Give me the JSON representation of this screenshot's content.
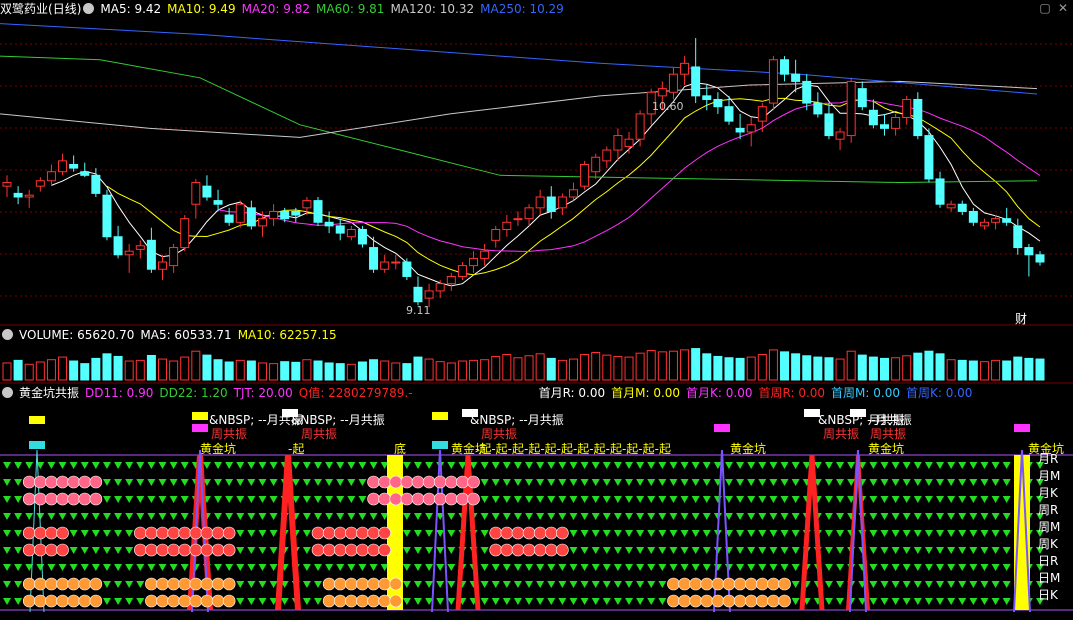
{
  "window": {
    "title": "双鹭药业",
    "period": "(日线)"
  },
  "price_panel": {
    "ma": [
      {
        "label": "MA5: 9.42",
        "color": "#ffffff"
      },
      {
        "label": "MA10: 9.49",
        "color": "#ffff00"
      },
      {
        "label": "MA20: 9.82",
        "color": "#ff33ff"
      },
      {
        "label": "MA60: 9.81",
        "color": "#33cc33"
      },
      {
        "label": "MA120: 10.32",
        "color": "#c8c8c8"
      },
      {
        "label": "MA250: 10.29",
        "color": "#3366ff"
      }
    ],
    "high_label": "10.60",
    "low_label": "9.11",
    "badge": "财"
  },
  "volume_panel": {
    "title": "VOLUME: 65620.70",
    "ma5": "MA5: 60533.71",
    "ma10": "MA10: 62257.15"
  },
  "indicator_panel": {
    "title": "黄金坑共振",
    "params": [
      {
        "label": "DD11: 0.90",
        "color": "#ff33ff"
      },
      {
        "label": "DD22: 1.20",
        "color": "#33cc33"
      },
      {
        "label": "TJT: 20.00",
        "color": "#ff33ff"
      },
      {
        "label": "Q值: 2280279789.-",
        "color": "#ff2222"
      },
      {
        "label": "首月R: 0.00",
        "color": "#ffffff"
      },
      {
        "label": "首月M: 0.00",
        "color": "#ffff00"
      },
      {
        "label": "首月K: 0.00",
        "color": "#ff33ff"
      },
      {
        "label": "首周R: 0.00",
        "color": "#ff2222"
      },
      {
        "label": "首周M: 0.00",
        "color": "#33ccff"
      },
      {
        "label": "首周K: 0.00",
        "color": "#3366ff"
      }
    ],
    "row_labels": [
      "月R",
      "月M",
      "月K",
      "周R",
      "周M",
      "周K",
      "日R",
      "日M",
      "日K"
    ],
    "texts": {
      "nbsp_a": "&NBSP; --月共振",
      "nbsp_b": "&NBSP; --月共振",
      "nbsp_c": "&NBSP; --月共振",
      "nbsp_d": "&NBSP; --月共振",
      "zhou_a": "周共振",
      "zhou_b": "周共振",
      "zhou_c": "周共振",
      "zhou_d": "周共振",
      "zhou_e": "周共振",
      "hjk_a": "黄金坑",
      "hjk_b": "黄金坑",
      "hjk_c": "黄金坑",
      "hjk_d": "黄金坑",
      "hjk_e": "黄金坑",
      "di": "底",
      "qi": "-起",
      "qi_run": "-起-起-起-起-起-起-起-起-起-起-起-起",
      "yue_gong": "月共振"
    }
  },
  "chart_data": {
    "type": "candlestick",
    "title": "双鹭药业 (日线)",
    "annotations": {
      "high": 10.6,
      "low": 9.11
    },
    "y_ticks_hidden": true,
    "ma_values": {
      "MA5": 9.42,
      "MA10": 9.49,
      "MA20": 9.82,
      "MA60": 9.81,
      "MA120": 10.32,
      "MA250": 10.29
    },
    "candles": [
      [
        9.78,
        9.84,
        9.72,
        9.8
      ],
      [
        9.74,
        9.78,
        9.68,
        9.72
      ],
      [
        9.72,
        9.76,
        9.66,
        9.73
      ],
      [
        9.78,
        9.83,
        9.75,
        9.81
      ],
      [
        9.81,
        9.9,
        9.79,
        9.86
      ],
      [
        9.86,
        9.96,
        9.84,
        9.92
      ],
      [
        9.9,
        9.95,
        9.86,
        9.88
      ],
      [
        9.86,
        9.91,
        9.83,
        9.84
      ],
      [
        9.84,
        9.88,
        9.72,
        9.74
      ],
      [
        9.73,
        9.76,
        9.48,
        9.5
      ],
      [
        9.5,
        9.56,
        9.38,
        9.4
      ],
      [
        9.4,
        9.46,
        9.3,
        9.42
      ],
      [
        9.43,
        9.48,
        9.38,
        9.45
      ],
      [
        9.48,
        9.55,
        9.3,
        9.32
      ],
      [
        9.32,
        9.4,
        9.26,
        9.36
      ],
      [
        9.34,
        9.46,
        9.3,
        9.44
      ],
      [
        9.44,
        9.62,
        9.42,
        9.6
      ],
      [
        9.68,
        9.82,
        9.6,
        9.8
      ],
      [
        9.78,
        9.84,
        9.7,
        9.72
      ],
      [
        9.7,
        9.76,
        9.64,
        9.68
      ],
      [
        9.62,
        9.66,
        9.56,
        9.58
      ],
      [
        9.58,
        9.7,
        9.55,
        9.68
      ],
      [
        9.66,
        9.7,
        9.54,
        9.56
      ],
      [
        9.56,
        9.64,
        9.5,
        9.6
      ],
      [
        9.6,
        9.68,
        9.56,
        9.64
      ],
      [
        9.64,
        9.66,
        9.58,
        9.6
      ],
      [
        9.64,
        9.66,
        9.58,
        9.62
      ],
      [
        9.66,
        9.72,
        9.62,
        9.7
      ],
      [
        9.7,
        9.72,
        9.56,
        9.58
      ],
      [
        9.58,
        9.64,
        9.52,
        9.56
      ],
      [
        9.56,
        9.6,
        9.48,
        9.52
      ],
      [
        9.5,
        9.56,
        9.48,
        9.54
      ],
      [
        9.54,
        9.56,
        9.44,
        9.46
      ],
      [
        9.44,
        9.5,
        9.3,
        9.32
      ],
      [
        9.32,
        9.4,
        9.3,
        9.36
      ],
      [
        9.36,
        9.4,
        9.32,
        9.36
      ],
      [
        9.36,
        9.38,
        9.26,
        9.28
      ],
      [
        9.22,
        9.28,
        9.12,
        9.14
      ],
      [
        9.16,
        9.24,
        9.11,
        9.2
      ],
      [
        9.2,
        9.26,
        9.16,
        9.24
      ],
      [
        9.24,
        9.3,
        9.2,
        9.28
      ],
      [
        9.28,
        9.36,
        9.26,
        9.34
      ],
      [
        9.34,
        9.42,
        9.3,
        9.38
      ],
      [
        9.38,
        9.46,
        9.34,
        9.42
      ],
      [
        9.48,
        9.56,
        9.44,
        9.54
      ],
      [
        9.54,
        9.62,
        9.5,
        9.58
      ],
      [
        9.6,
        9.64,
        9.56,
        9.6
      ],
      [
        9.6,
        9.68,
        9.56,
        9.66
      ],
      [
        9.66,
        9.76,
        9.62,
        9.72
      ],
      [
        9.72,
        9.78,
        9.6,
        9.64
      ],
      [
        9.66,
        9.74,
        9.62,
        9.72
      ],
      [
        9.72,
        9.8,
        9.7,
        9.76
      ],
      [
        9.78,
        9.92,
        9.76,
        9.9
      ],
      [
        9.86,
        9.96,
        9.82,
        9.94
      ],
      [
        9.92,
        10.0,
        9.88,
        9.98
      ],
      [
        9.98,
        10.1,
        9.92,
        10.06
      ],
      [
        10.0,
        10.08,
        9.96,
        10.04
      ],
      [
        10.04,
        10.2,
        10.0,
        10.18
      ],
      [
        10.18,
        10.32,
        10.12,
        10.3
      ],
      [
        10.28,
        10.36,
        10.2,
        10.32
      ],
      [
        10.3,
        10.44,
        10.26,
        10.4
      ],
      [
        10.4,
        10.5,
        10.34,
        10.46
      ],
      [
        10.44,
        10.6,
        10.24,
        10.28
      ],
      [
        10.28,
        10.34,
        10.2,
        10.26
      ],
      [
        10.26,
        10.3,
        10.18,
        10.22
      ],
      [
        10.22,
        10.28,
        10.12,
        10.14
      ],
      [
        10.1,
        10.18,
        10.04,
        10.08
      ],
      [
        10.08,
        10.16,
        10.0,
        10.12
      ],
      [
        10.14,
        10.24,
        10.08,
        10.22
      ],
      [
        10.24,
        10.5,
        10.2,
        10.48
      ],
      [
        10.48,
        10.5,
        10.36,
        10.4
      ],
      [
        10.4,
        10.48,
        10.3,
        10.36
      ],
      [
        10.36,
        10.4,
        10.2,
        10.24
      ],
      [
        10.24,
        10.3,
        10.16,
        10.18
      ],
      [
        10.18,
        10.24,
        10.04,
        10.06
      ],
      [
        10.04,
        10.1,
        9.98,
        10.08
      ],
      [
        10.06,
        10.38,
        10.02,
        10.36
      ],
      [
        10.32,
        10.36,
        10.2,
        10.22
      ],
      [
        10.2,
        10.26,
        10.1,
        10.12
      ],
      [
        10.12,
        10.18,
        10.06,
        10.1
      ],
      [
        10.1,
        10.18,
        10.06,
        10.16
      ],
      [
        10.16,
        10.28,
        10.12,
        10.26
      ],
      [
        10.26,
        10.3,
        10.04,
        10.06
      ],
      [
        10.06,
        10.1,
        9.8,
        9.82
      ],
      [
        9.82,
        9.86,
        9.66,
        9.68
      ],
      [
        9.66,
        9.7,
        9.64,
        9.68
      ],
      [
        9.68,
        9.7,
        9.62,
        9.64
      ],
      [
        9.64,
        9.66,
        9.56,
        9.58
      ],
      [
        9.56,
        9.6,
        9.54,
        9.58
      ],
      [
        9.58,
        9.62,
        9.54,
        9.6
      ],
      [
        9.6,
        9.66,
        9.56,
        9.58
      ],
      [
        9.56,
        9.6,
        9.4,
        9.44
      ],
      [
        9.44,
        9.46,
        9.28,
        9.4
      ],
      [
        9.4,
        9.42,
        9.34,
        9.36
      ]
    ],
    "volume": [
      52,
      60,
      48,
      55,
      62,
      70,
      58,
      50,
      66,
      80,
      72,
      58,
      60,
      75,
      64,
      58,
      70,
      88,
      76,
      62,
      55,
      60,
      58,
      52,
      50,
      56,
      54,
      62,
      58,
      52,
      50,
      48,
      55,
      62,
      58,
      52,
      50,
      70,
      64,
      56,
      52,
      58,
      60,
      62,
      72,
      78,
      68,
      74,
      80,
      66,
      60,
      64,
      78,
      84,
      76,
      72,
      70,
      82,
      90,
      86,
      88,
      92,
      96,
      80,
      72,
      68,
      66,
      70,
      78,
      92,
      86,
      80,
      74,
      70,
      68,
      64,
      88,
      76,
      70,
      66,
      68,
      74,
      82,
      88,
      80,
      62,
      60,
      58,
      56,
      60,
      58,
      70,
      66,
      64
    ],
    "indicator": {
      "rows": [
        "月R",
        "月M",
        "月K",
        "周R",
        "周M",
        "周K",
        "日R",
        "日M",
        "日K"
      ]
    }
  }
}
